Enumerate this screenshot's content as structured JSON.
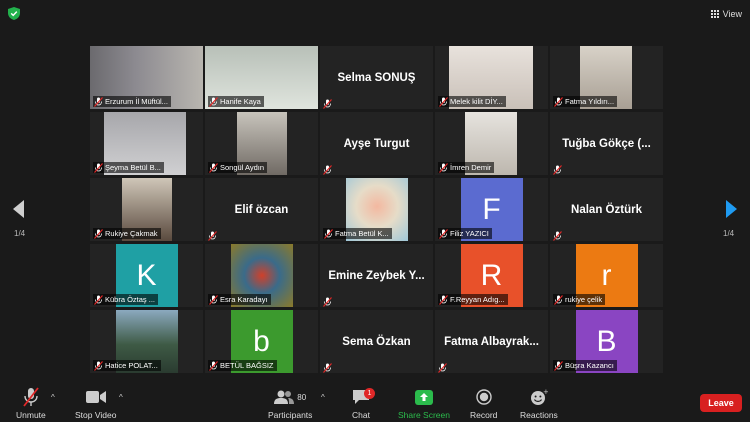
{
  "topbar": {
    "view_label": "View"
  },
  "pager": {
    "left_label": "1/4",
    "right_label": "1/4"
  },
  "participants": [
    {
      "name": "Erzurum İl Müftül...",
      "type": "video",
      "active": true
    },
    {
      "name": "Hanife Kaya",
      "type": "video"
    },
    {
      "name": "Selma SONUŞ",
      "type": "text"
    },
    {
      "name": "Melek kilit DİY...",
      "type": "video"
    },
    {
      "name": "Fatma Yıldırı...",
      "type": "video"
    },
    {
      "name": "Şeyma Betül B...",
      "type": "video"
    },
    {
      "name": "Songül Aydın",
      "type": "video"
    },
    {
      "name": "Ayşe Turgut",
      "type": "text"
    },
    {
      "name": "İmren Demir",
      "type": "video"
    },
    {
      "name": "Tuğba Gökçe (...",
      "type": "text"
    },
    {
      "name": "Rukiye Çakmak",
      "type": "video"
    },
    {
      "name": "Elif özcan",
      "type": "text"
    },
    {
      "name": "Fatma Betül K...",
      "type": "video"
    },
    {
      "name": "Filiz YAZICI",
      "type": "avatar",
      "initial": "F",
      "color": "#5b6bd0"
    },
    {
      "name": "Nalan Öztürk",
      "type": "text"
    },
    {
      "name": "Kübra Öztaş ...",
      "type": "avatar",
      "initial": "K",
      "color": "#1fa0a4"
    },
    {
      "name": "Esra Karadayı",
      "type": "video"
    },
    {
      "name": "Emine Zeybek Y...",
      "type": "text"
    },
    {
      "name": "F.Reyyan Adıg...",
      "type": "avatar",
      "initial": "R",
      "color": "#e8512a"
    },
    {
      "name": "rukiye çelik",
      "type": "avatar",
      "initial": "r",
      "color": "#ec7a12"
    },
    {
      "name": "Hatice POLAT...",
      "type": "video"
    },
    {
      "name": "BETÜL BAĞSIZ",
      "type": "avatar",
      "initial": "b",
      "color": "#3c9a2e"
    },
    {
      "name": "Sema Özkan",
      "type": "text"
    },
    {
      "name": "Fatma Albayrak...",
      "type": "text"
    },
    {
      "name": "Büşra Kazancı",
      "type": "avatar",
      "initial": "B",
      "color": "#8a45c2"
    }
  ],
  "toolbar": {
    "unmute": "Unmute",
    "stop_video": "Stop Video",
    "participants": "Participants",
    "participants_count": "80",
    "chat": "Chat",
    "chat_badge": "1",
    "share_screen": "Share Screen",
    "record": "Record",
    "reactions": "Reactions",
    "leave": "Leave"
  },
  "colors": {
    "active_border": "#d6e14b",
    "leave": "#d82020",
    "share": "#2bbb4c"
  }
}
